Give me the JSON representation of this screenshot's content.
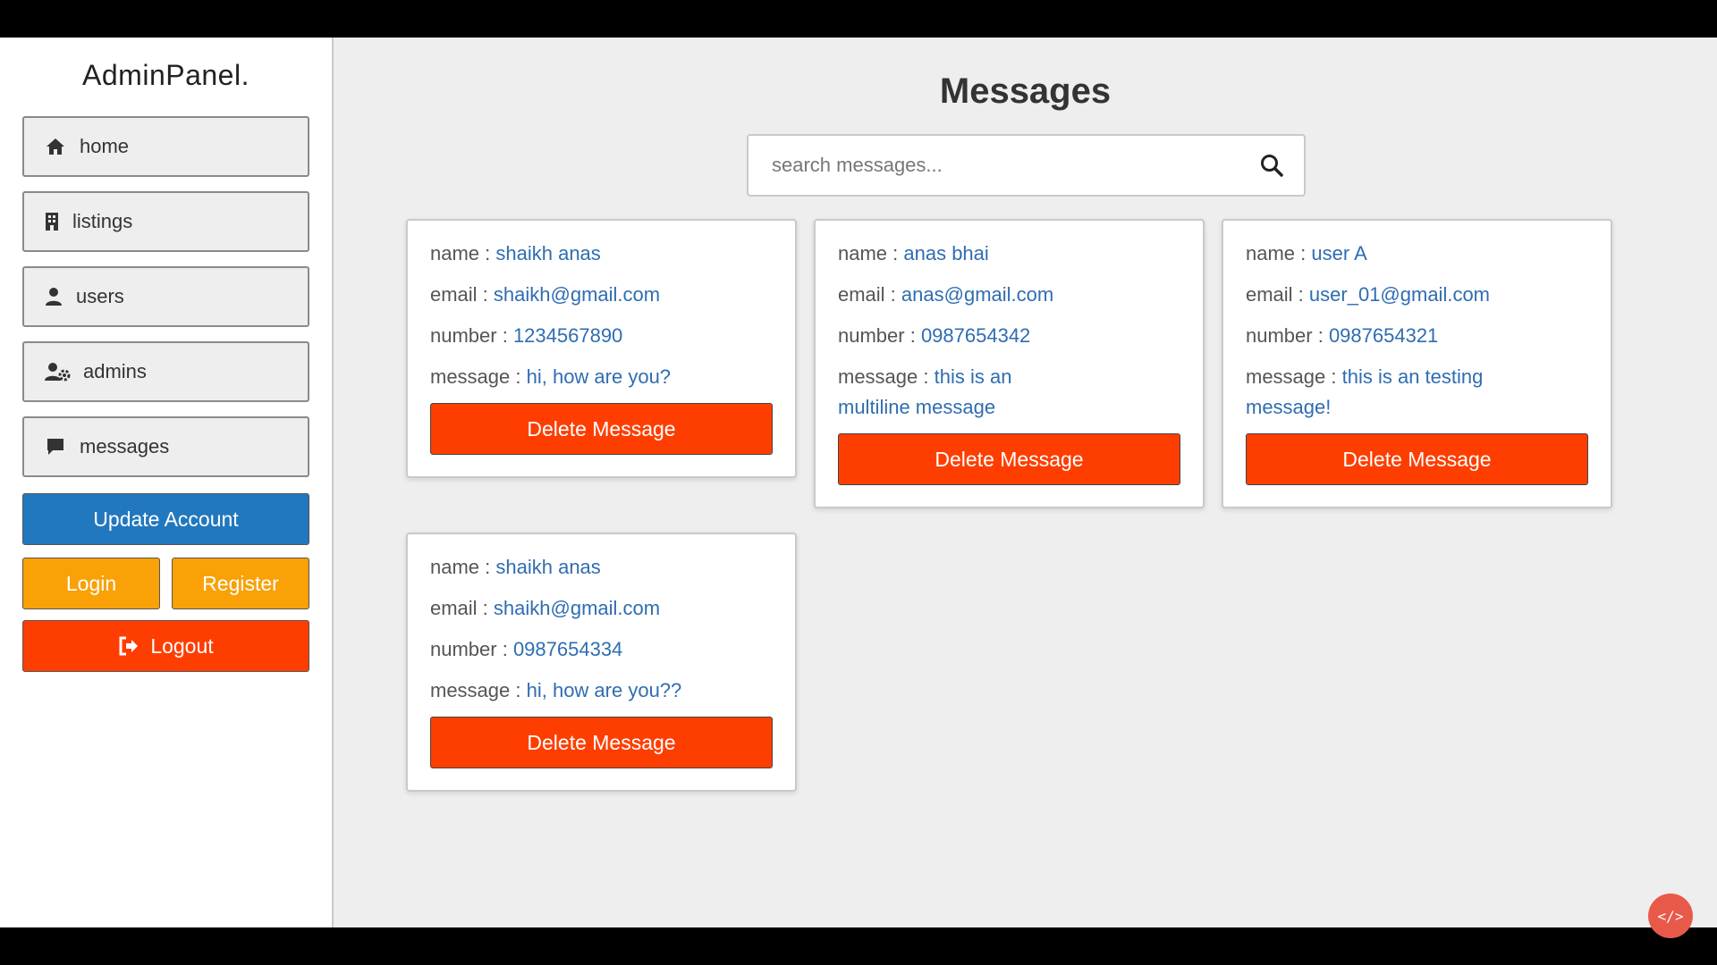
{
  "sidebar": {
    "logo": "AdminPanel.",
    "items": [
      {
        "label": "home",
        "icon": "home-icon"
      },
      {
        "label": "listings",
        "icon": "building-icon"
      },
      {
        "label": "users",
        "icon": "user-icon"
      },
      {
        "label": "admins",
        "icon": "user-gear-icon"
      },
      {
        "label": "messages",
        "icon": "comment-icon"
      }
    ],
    "update_account": "Update Account",
    "login": "Login",
    "register": "Register",
    "logout": "Logout"
  },
  "main": {
    "title": "Messages",
    "search_placeholder": "search messages...",
    "labels": {
      "name": "name : ",
      "email": "email : ",
      "number": "number : ",
      "message": "message : "
    },
    "delete_label": "Delete Message",
    "messages": [
      {
        "name": "shaikh anas",
        "email": "shaikh@gmail.com",
        "number": "1234567890",
        "message": "hi, how are you?"
      },
      {
        "name": "anas bhai",
        "email": "anas@gmail.com",
        "number": "0987654342",
        "message": "this is an multiline message"
      },
      {
        "name": "user A",
        "email": "user_01@gmail.com",
        "number": "0987654321",
        "message": "this is an testing message!"
      },
      {
        "name": "shaikh anas",
        "email": "shaikh@gmail.com",
        "number": "0987654334",
        "message": "hi, how are you??"
      }
    ]
  },
  "colors": {
    "primary_blue": "#2278be",
    "warning_orange": "#f9a107",
    "danger_red": "#fe3e00",
    "value_text": "#2f6db1"
  }
}
